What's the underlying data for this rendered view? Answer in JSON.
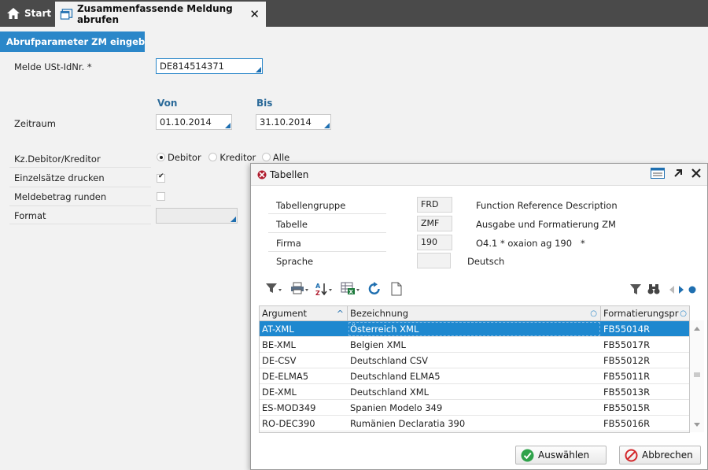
{
  "tabs": {
    "start_label": "Start",
    "active_label": "Zusammenfassende Meldung abrufen",
    "close_glyph": "✕"
  },
  "section": {
    "title": "Abrufparameter ZM eingeben"
  },
  "form": {
    "ustid_label": "Melde USt-IdNr. *",
    "ustid_value": "DE814514371",
    "von_label": "Von",
    "bis_label": "Bis",
    "zeitraum_label": "Zeitraum",
    "von_value": "01.10.2014",
    "bis_value": "31.10.2014",
    "kz_label": "Kz.Debitor/Kreditor",
    "radio_debitor": "Debitor",
    "radio_kreditor": "Kreditor",
    "radio_alle": "Alle",
    "einzel_label": "Einzelsätze drucken",
    "runden_label": "Meldebetrag runden",
    "format_label": "Format",
    "format_value": ""
  },
  "dialog": {
    "title": "Tabellen",
    "params": [
      {
        "label": "Tabellengruppe",
        "value": "FRD",
        "desc": "Function Reference Description"
      },
      {
        "label": "Tabelle",
        "value": "ZMF",
        "desc": "Ausgabe und Formatierung ZM"
      },
      {
        "label": "Firma",
        "value": "190",
        "desc": "O4.1 * oxaion ag 190   *"
      },
      {
        "label": "Sprache",
        "value": "",
        "desc": "Deutsch"
      }
    ],
    "columns": [
      "Argument",
      "Bezeichnung",
      "Formatierungspr"
    ],
    "rows": [
      [
        "AT-XML",
        "Österreich XML",
        "FB55014R"
      ],
      [
        "BE-XML",
        "Belgien XML",
        "FB55017R"
      ],
      [
        "DE-CSV",
        "Deutschland CSV",
        "FB55012R"
      ],
      [
        "DE-ELMA5",
        "Deutschland ELMA5",
        "FB55011R"
      ],
      [
        "DE-XML",
        "Deutschland XML",
        "FB55013R"
      ],
      [
        "ES-MOD349",
        "Spanien Modelo 349",
        "FB55015R"
      ],
      [
        "RO-DEC390",
        "Rumänien Declaratia 390",
        "FB55016R"
      ]
    ],
    "btn_ok": "Auswählen",
    "btn_cancel": "Abbrechen"
  },
  "colors": {
    "accent": "#2b87c9",
    "topbar": "#4a4a4a",
    "selected_row": "#1e88cf"
  }
}
